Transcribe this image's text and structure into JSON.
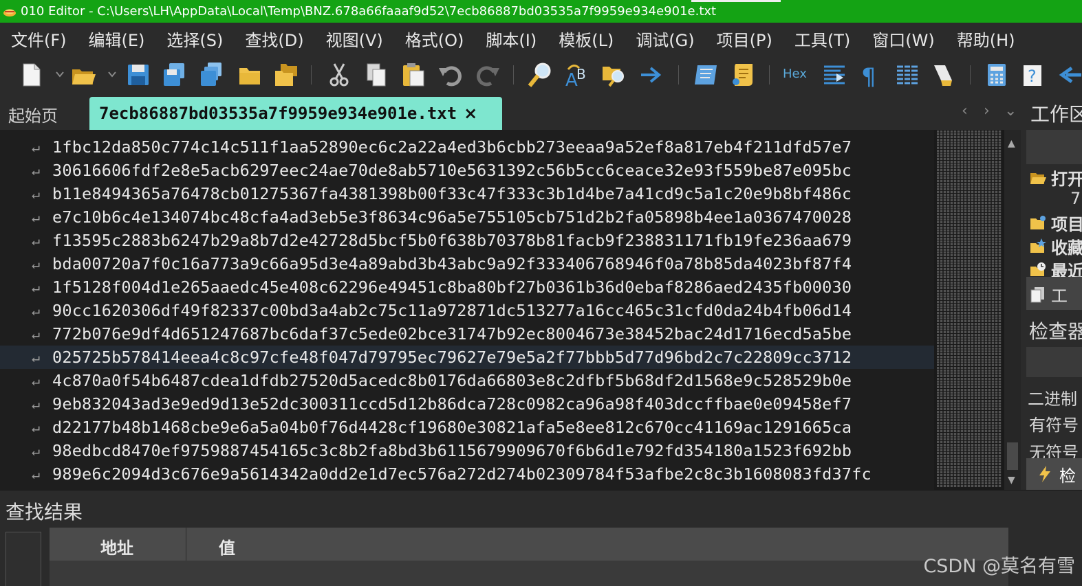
{
  "window": {
    "title": "010 Editor - C:\\Users\\LH\\AppData\\Local\\Temp\\BNZ.678a66faaaf9d52\\7ecb86887bd03535a7f9959e934e901e.txt"
  },
  "menu": {
    "items": [
      "文件(F)",
      "编辑(E)",
      "选择(S)",
      "查找(D)",
      "视图(V)",
      "格式(O)",
      "脚本(I)",
      "模板(L)",
      "调试(G)",
      "项目(P)",
      "工具(T)",
      "窗口(W)",
      "帮助(H)"
    ]
  },
  "toolbar": {
    "hex_label": "Hex"
  },
  "tabs": {
    "start_label": "起始页",
    "active_label": "7ecb86887bd03535a7f9959e934e901e.txt",
    "close_glyph": "×",
    "nav_prev": "‹",
    "nav_next": "›",
    "nav_menu": "⌄"
  },
  "editor": {
    "line_marker": "↵",
    "current_line_index": 9,
    "lines": [
      "1fbc12da850c774c14c511f1aa52890ec6c2a22a4ed3b6cbb273eeaa9a52ef8a817eb4f211dfd57e7",
      "30616606fdf2e8e5acb6297eec24ae70de8ab5710e5631392c56b5cc6ceace32e93f559be87e095bc",
      "b11e8494365a76478cb01275367fa4381398b00f33c47f333c3b1d4be7a41cd9c5a1c20e9b8bf486c",
      "e7c10b6c4e134074bc48cfa4ad3eb5e3f8634c96a5e755105cb751d2b2fa05898b4ee1a0367470028",
      "f13595c2883b6247b29a8b7d2e42728d5bcf5b0f638b70378b81facb9f238831171fb19fe236aa679",
      "bda00720a7f0c16a773a9c66a95d3e4a89abd3b43abc9a92f333406768946f0a78b85da4023bf87f4",
      "1f5128f004d1e265aaedc45e408c62296e49451c8ba80bf27b0361b36d0ebaf8286aed2435fb00030",
      "90cc1620306df49f82337c00bd3a4ab2c75c11a972871dc513277a16cc465c31cfd0da24b4fb06d14",
      "772b076e9df4d651247687bc6daf37c5ede02bce31747b92ec8004673e38452bac24d1716ecd5a5be",
      "025725b578414eea4c8c97cfe48f047d79795ec79627e79e5a2f77bbb5d77d96bd2c7c22809cc3712",
      "4c870a0f54b6487cdea1dfdb27520d5acedc8b0176da66803e8c2dfbf5b68df2d1568e9c528529b0e",
      "9eb832043ad3e9ed9d13e52dc300311ccd5d12b86dca728c0982ca96a98f403dccffbae0e09458ef7",
      "d22177b48b1468cbe9e6a5a04b0f76d4428cf19680e30821afa5e8ee812c670cc41169ac1291665ca",
      "98edbcd8470ef9759887454165c3c8b2fa8bd3b6115679909670f6b6d1e792fd354180a1523f692bb",
      "989e6c2094d3c676e9a5614342a0dd2e1d7ec576a272d274b02309784f53afbe2c8c3b1608083fd37fc"
    ]
  },
  "right_panel": {
    "title": "工作区",
    "open_label": "打开",
    "open_count": "7",
    "project_label": "项目",
    "favorites_label": "收藏",
    "recent_label": "最近",
    "tools_label": "工",
    "inspector_title": "检查器",
    "binary_label": "二进制",
    "signed_label": "有符号",
    "unsigned_label": "无符号",
    "inspect_button": "检"
  },
  "find_results": {
    "title": "查找结果",
    "columns": [
      "地址",
      "值"
    ]
  },
  "watermark": "CSDN @莫名有雪",
  "colors": {
    "title_bar": "#14a314",
    "active_tab": "#7ee6cf",
    "editor_bg": "#1e1e1e",
    "accent_blue": "#3d8fd6",
    "folder_yellow": "#e8b83a"
  }
}
